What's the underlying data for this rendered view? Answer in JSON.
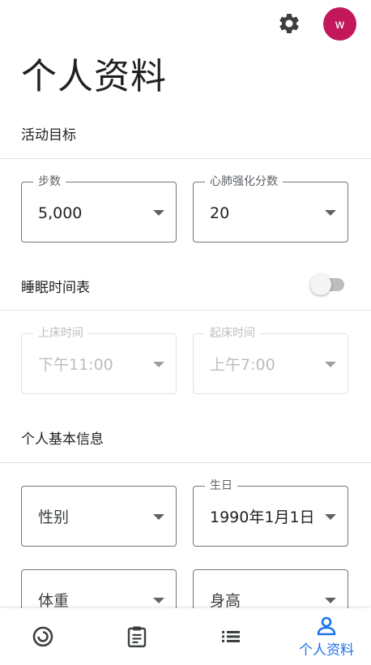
{
  "header": {
    "settings_icon": "gear-icon",
    "avatar_letter": "w",
    "avatar_color": "#c2185b"
  },
  "page_title": "个人资料",
  "activity_goals": {
    "title": "活动目标",
    "steps": {
      "label": "步数",
      "value": "5,000"
    },
    "heart_points": {
      "label": "心肺强化分数",
      "value": "20"
    }
  },
  "sleep_schedule": {
    "title": "睡眠时间表",
    "enabled": false,
    "bedtime": {
      "label": "上床时间",
      "value": "下午11:00"
    },
    "wake_time": {
      "label": "起床时间",
      "value": "上午7:00"
    }
  },
  "personal_info": {
    "title": "个人基本信息",
    "gender": {
      "placeholder": "性别"
    },
    "birthday": {
      "label": "生日",
      "value": "1990年1月1日"
    },
    "weight": {
      "placeholder": "体重"
    },
    "height": {
      "placeholder": "身高"
    }
  },
  "bottom_nav": {
    "accent_color": "#1a73e8",
    "items": [
      {
        "icon": "home-ring-icon",
        "label": ""
      },
      {
        "icon": "journal-clipboard-icon",
        "label": ""
      },
      {
        "icon": "browse-list-icon",
        "label": ""
      },
      {
        "icon": "profile-person-icon",
        "label": "个人资料",
        "active": true
      }
    ]
  }
}
